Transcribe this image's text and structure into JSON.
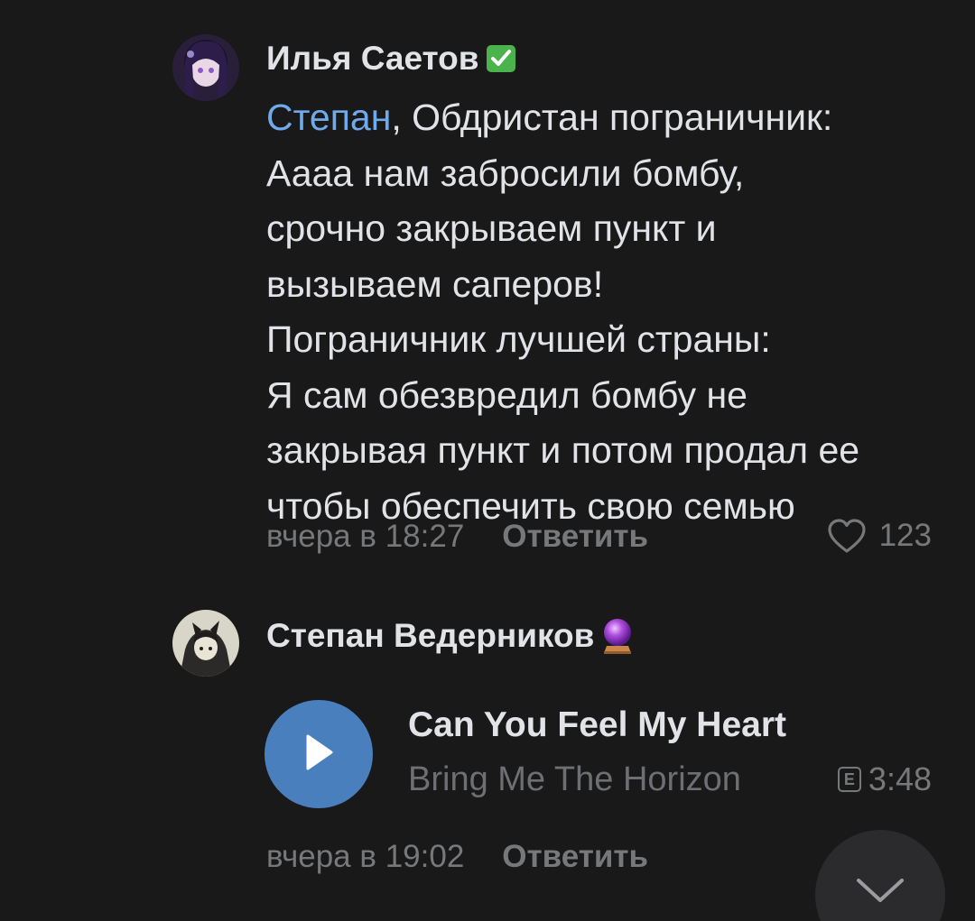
{
  "comments": [
    {
      "author": "Илья Саетов",
      "badge_icon": "verified-check-icon",
      "mention": "Степан",
      "text": ", Обдристан пограничник:\nАааа нам забросили бомбу,\nсрочно закрываем пункт и\nвызываем саперов!\nПограничник лучшей страны:\nЯ сам обезвредил бомбу не\nзакрывая пункт и потом продал ее\nчтобы обеспечить свою семью",
      "time": "вчера в 18:27",
      "reply_label": "Ответить",
      "likes": "123"
    },
    {
      "author": "Степан Ведерников",
      "badge_icon": "crystal-ball-icon",
      "audio": {
        "title": "Can You Feel My Heart",
        "artist": "Bring Me The Horizon",
        "explicit_mark": "E",
        "duration": "3:48"
      },
      "time": "вчера в 19:02",
      "reply_label": "Ответить"
    }
  ],
  "colors": {
    "background": "#19191a",
    "text": "#e1e3e6",
    "secondary": "#76787a",
    "mention": "#71aaeb",
    "play_button": "#4a7fbe",
    "verified": "#4bb34b"
  }
}
